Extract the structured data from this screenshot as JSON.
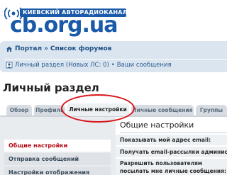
{
  "header": {
    "tagline": "КИЕВСКИЙ АВТОРАДИОКАНАЛ",
    "logo_text": "cb.org.ua"
  },
  "navbar": {
    "portal": "Портал",
    "separator": "»",
    "forums": "Список форумов",
    "personal_section": "Личный раздел (Новых ЛС: 0)",
    "bullet": "•",
    "your_messages": "Ваши сообщения"
  },
  "page": {
    "title": "Личный раздел"
  },
  "tabs": [
    {
      "label": "Обзор"
    },
    {
      "label": "Профиль"
    },
    {
      "label": "Личные настройки",
      "active": true
    },
    {
      "label": "Личные сообщения"
    },
    {
      "label": "Группы"
    }
  ],
  "sidebar": {
    "items": [
      {
        "label": "Общие настройки",
        "active": true
      },
      {
        "label": "Отправка сообщений"
      },
      {
        "label": "Настройки отображения"
      }
    ]
  },
  "content": {
    "heading": "Общие настройки",
    "rows": [
      {
        "label": "Показывать мой адрес email:"
      },
      {
        "label": "Получать email-рассылки администрации:"
      },
      {
        "label": "Разрешить пользователям посылать мне личные сообщения:"
      }
    ]
  },
  "colors": {
    "brand": "#1a5aa8",
    "navbar_bg": "#dbe5ef",
    "highlight": "#d8141a",
    "active_menu_text": "#b40a17"
  }
}
